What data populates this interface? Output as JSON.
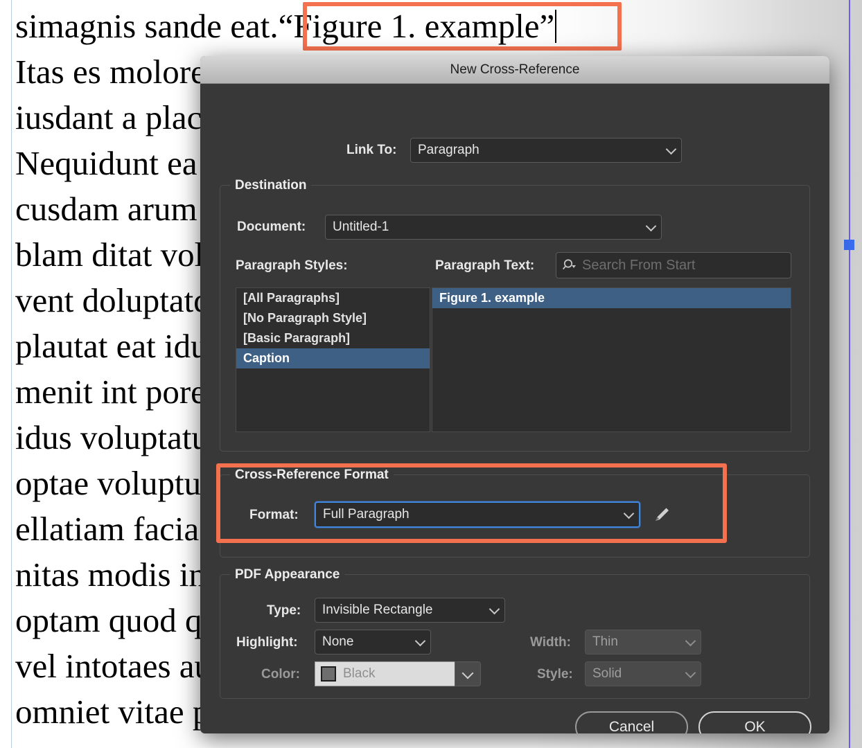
{
  "document": {
    "lines": [
      "simagnis sande eat.",
      "Itas es molorerum fugitatenis es quatem e",
      "iusdant a placeaq uibusanda nonsed qui",
      "Nequidunt ea venimax imusdanihit quide",
      "cusdam arum aceaqui a sim doluptam est",
      "blam ditat voluptat eturit aut et omnihil",
      "vent doluptatquos ea quiatest, totatecto",
      "plautat eat idus aut exerecus dolut endel-",
      "menit int porepudae nimus sum et quod",
      "idus voluptaturi officiis maximus dande",
      "optae voluptur aliquis sintiatur sequam",
      "ellatiam facias voluptat ut aut laboriate",
      "nitas modis inverumquo volupta tiusam",
      "optam quod que nonsequae volorep erum",
      "vel intotaes aut laboreri audae volupta",
      "omniet vitae pro blabore ritaspe rferitas"
    ],
    "caption_text": "“Figure 1. example”",
    "caption_prefix": "simagnis sande eat.",
    "annotation_color": "#f4714f",
    "frame_guide_color": "#6b5cf2"
  },
  "dialog": {
    "title": "New Cross-Reference",
    "link_to": {
      "label": "Link To:",
      "value": "Paragraph"
    },
    "destination": {
      "group_title": "Destination",
      "document": {
        "label": "Document:",
        "value": "Untitled-1"
      },
      "paragraph_styles": {
        "label": "Paragraph Styles:",
        "items": [
          {
            "label": "[All Paragraphs]",
            "selected": false
          },
          {
            "label": "[No Paragraph Style]",
            "selected": false
          },
          {
            "label": "[Basic Paragraph]",
            "selected": false
          },
          {
            "label": "Caption",
            "selected": true
          }
        ]
      },
      "paragraph_text": {
        "label": "Paragraph Text:",
        "search_placeholder": "Search From Start",
        "search_icon": "search-icon",
        "items": [
          {
            "label": "Figure 1. example",
            "selected": true
          }
        ]
      }
    },
    "xref_format": {
      "group_title": "Cross-Reference Format",
      "format": {
        "label": "Format:",
        "value": "Full Paragraph",
        "focused": true
      },
      "edit_icon": "pencil-icon",
      "highlight_color": "#f4714f"
    },
    "pdf_appearance": {
      "group_title": "PDF Appearance",
      "type": {
        "label": "Type:",
        "value": "Invisible Rectangle",
        "disabled": false
      },
      "highlight": {
        "label": "Highlight:",
        "value": "None",
        "disabled": false
      },
      "color": {
        "label": "Color:",
        "value": "Black",
        "swatch": "#6e6e6e",
        "disabled": true
      },
      "width": {
        "label": "Width:",
        "value": "Thin",
        "disabled": true
      },
      "style": {
        "label": "Style:",
        "value": "Solid",
        "disabled": true
      }
    },
    "buttons": {
      "cancel": "Cancel",
      "ok": "OK"
    }
  }
}
